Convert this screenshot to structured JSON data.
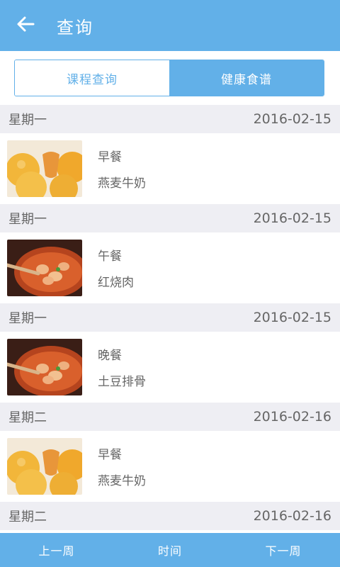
{
  "header": {
    "title": "查询",
    "back_icon": "arrow-left-icon"
  },
  "tabs": [
    {
      "label": "课程查询",
      "active": false
    },
    {
      "label": "健康食谱",
      "active": true
    }
  ],
  "entries": [
    {
      "weekday": "星期一",
      "date": "2016-02-15",
      "meal": "早餐",
      "dish": "燕麦牛奶",
      "image": "bread-image"
    },
    {
      "weekday": "星期一",
      "date": "2016-02-15",
      "meal": "午餐",
      "dish": "红烧肉",
      "image": "stew-image"
    },
    {
      "weekday": "星期一",
      "date": "2016-02-15",
      "meal": "晚餐",
      "dish": "土豆排骨",
      "image": "stew-image"
    },
    {
      "weekday": "星期二",
      "date": "2016-02-16",
      "meal": "早餐",
      "dish": "燕麦牛奶",
      "image": "bread-image"
    },
    {
      "weekday": "星期二",
      "date": "2016-02-16"
    }
  ],
  "bottom_nav": {
    "prev_week": "上一周",
    "time": "时间",
    "next_week": "下一周"
  },
  "colors": {
    "primary": "#62b0e8",
    "section_bg": "#eeeef3"
  }
}
